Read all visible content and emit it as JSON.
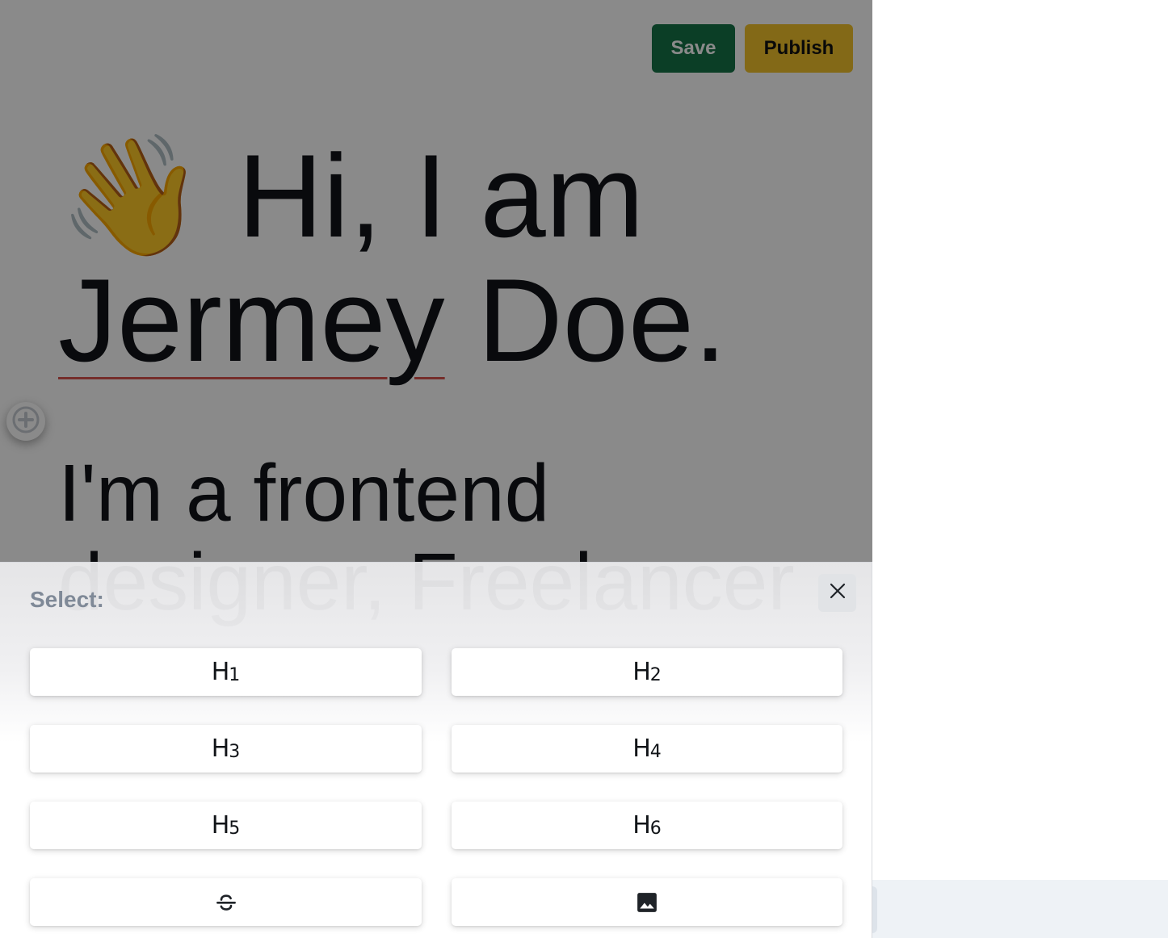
{
  "toolbar": {
    "save_label": "Save",
    "publish_label": "Publish"
  },
  "content": {
    "emoji": "👋",
    "heading_line1_text": "Hi, I am",
    "heading_name_first": "Jermey",
    "heading_name_rest": " Doe.",
    "subtitle_text": "I'm a frontend designer, Freelancer"
  },
  "sheet": {
    "title": "Select:",
    "options": [
      {
        "letter": "H",
        "level": "1"
      },
      {
        "letter": "H",
        "level": "2"
      },
      {
        "letter": "H",
        "level": "3"
      },
      {
        "letter": "H",
        "level": "4"
      },
      {
        "letter": "H",
        "level": "5"
      },
      {
        "letter": "H",
        "level": "6"
      }
    ],
    "extra_options": [
      {
        "icon": "strikethrough-icon"
      },
      {
        "icon": "image-icon"
      }
    ]
  },
  "colors": {
    "save": "#157347",
    "publish": "#f2c32b",
    "overlay": "rgba(0,0,0,0.46)",
    "spellcheck_underline": "#d9534f"
  }
}
